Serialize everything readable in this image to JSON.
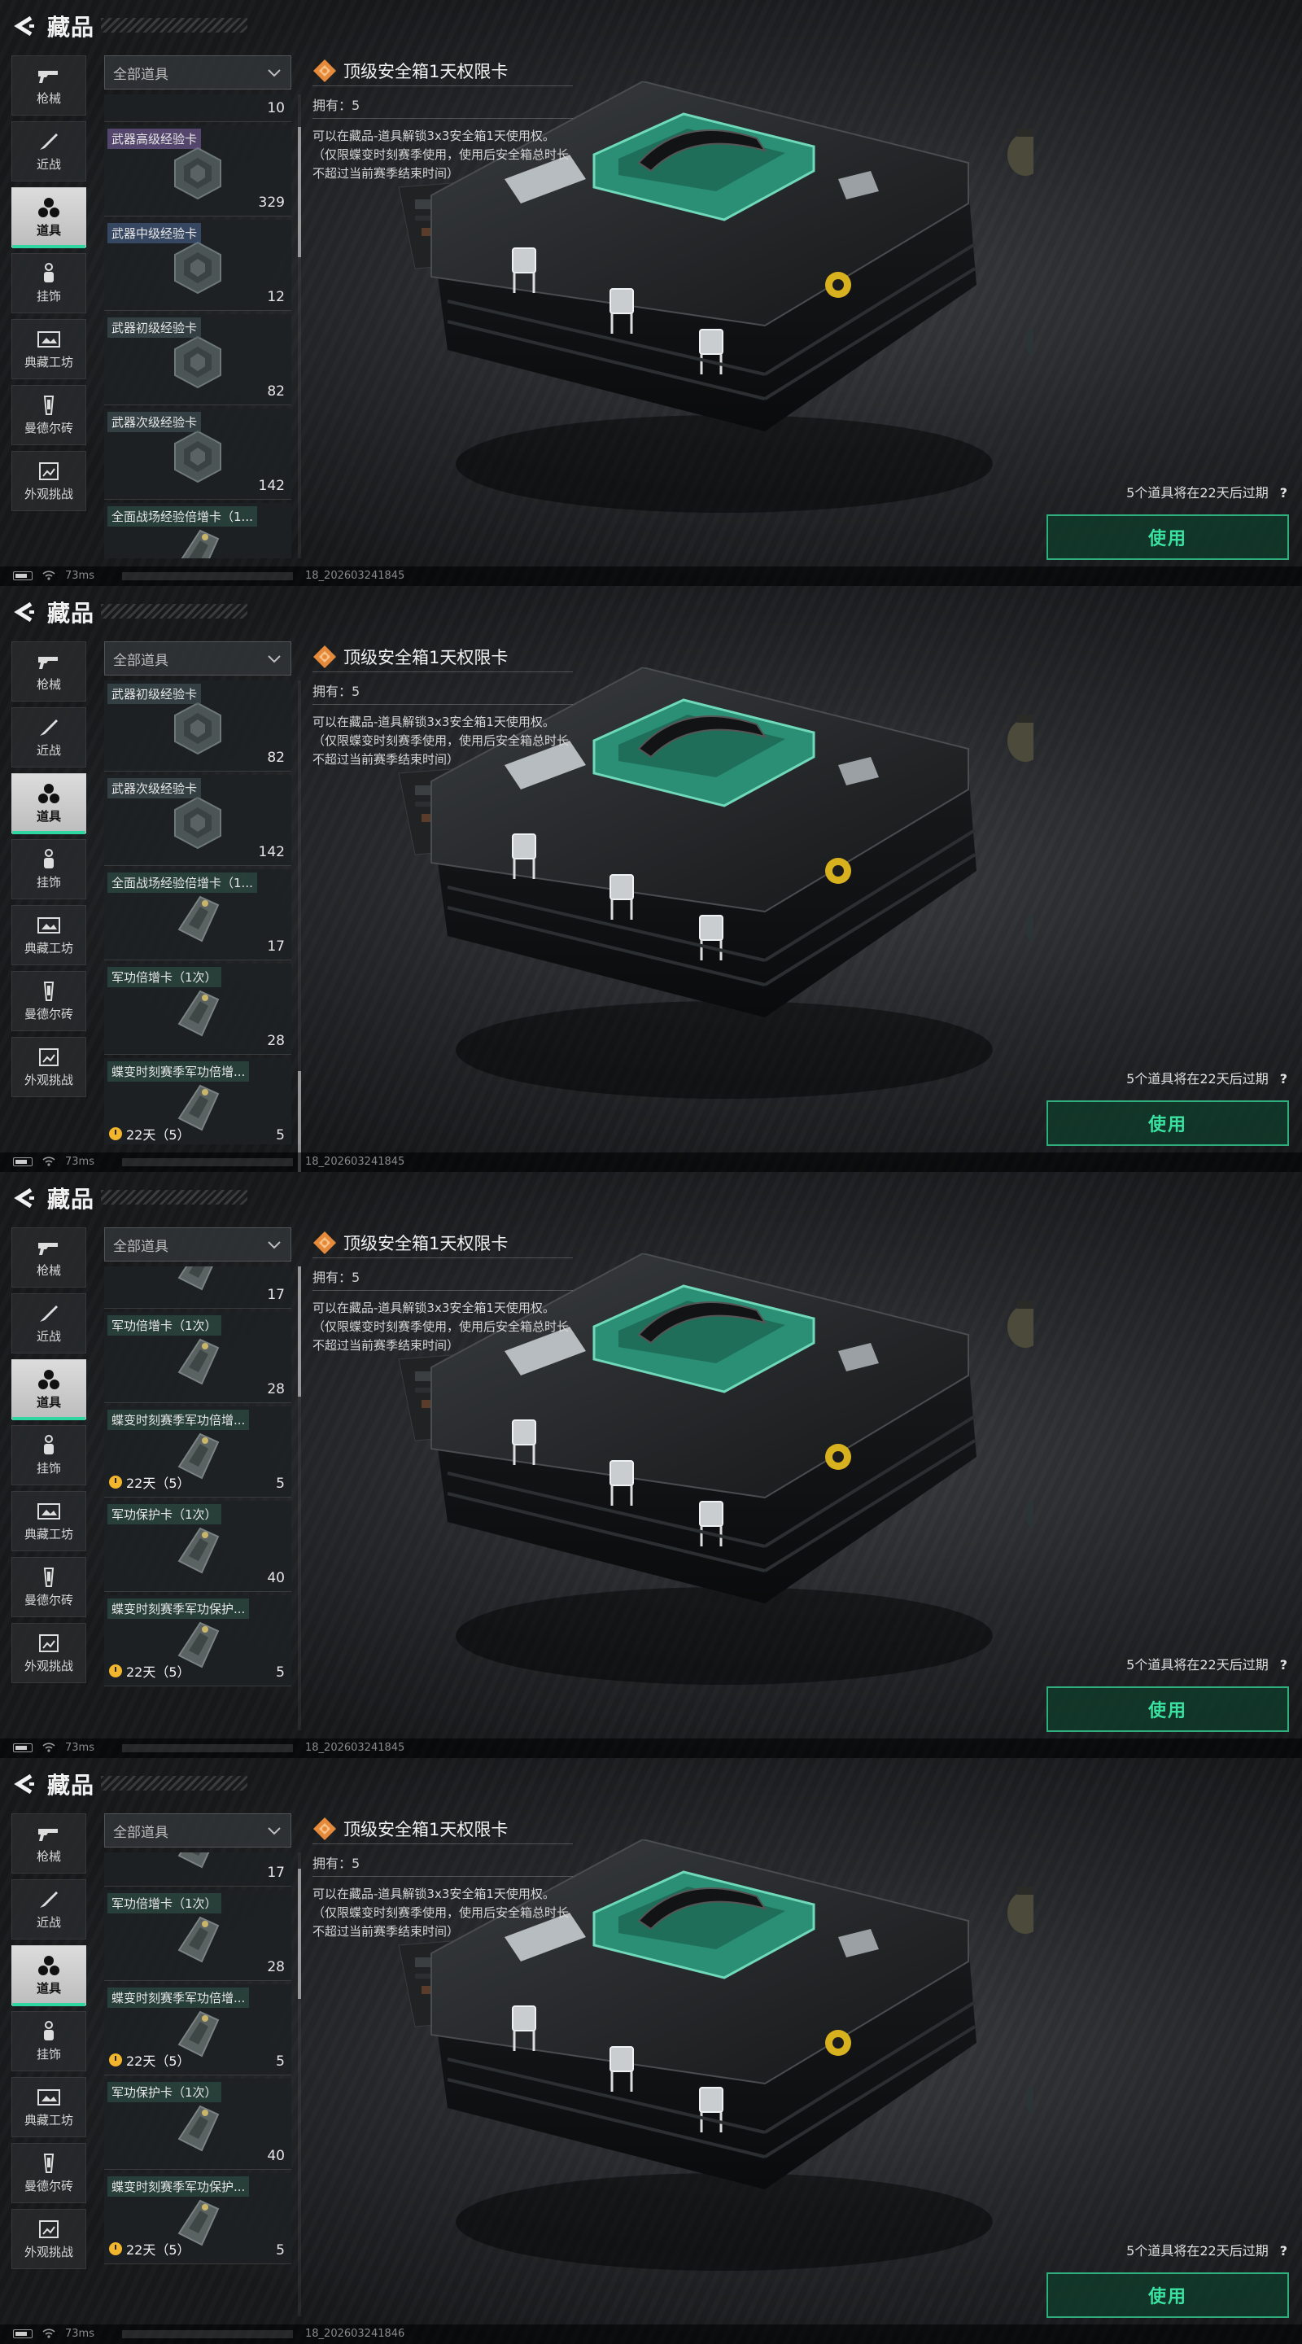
{
  "header": {
    "title": "藏品"
  },
  "nav": [
    {
      "label": "枪械",
      "icon": "gun-icon"
    },
    {
      "label": "近战",
      "icon": "knife-icon"
    },
    {
      "label": "道具",
      "icon": "items-icon"
    },
    {
      "label": "挂饰",
      "icon": "charm-icon"
    },
    {
      "label": "典藏工坊",
      "icon": "workshop-icon"
    },
    {
      "label": "曼德尔砖",
      "icon": "brick-icon"
    },
    {
      "label": "外观挑战",
      "icon": "challenge-icon"
    }
  ],
  "filter": {
    "label": "全部道具"
  },
  "detail": {
    "title": "顶级安全箱1天权限卡",
    "owned": "拥有：5",
    "description": "可以在藏品-道具解锁3x3安全箱1天使用权。（仅限蝶变时刻赛季使用，使用后安全箱总时长不超过当前赛季结束时间）",
    "expire_note": "5个道具将在22天后过期",
    "use_label": "使用"
  },
  "status": {
    "ping": "73ms"
  },
  "panels": [
    {
      "version": "18_202603241845",
      "items": [
        {
          "name": "",
          "qty": "10",
          "timer": ""
        },
        {
          "name": "武器高级经验卡",
          "qty": "329",
          "timer": ""
        },
        {
          "name": "武器中级经验卡",
          "qty": "12",
          "timer": ""
        },
        {
          "name": "武器初级经验卡",
          "qty": "82",
          "timer": ""
        },
        {
          "name": "武器次级经验卡",
          "qty": "142",
          "timer": ""
        },
        {
          "name": "全面战场经验倍增卡（1...",
          "qty": "",
          "timer": ""
        }
      ]
    },
    {
      "version": "18_202603241845",
      "items": [
        {
          "name": "武器初级经验卡",
          "qty": "82",
          "timer": ""
        },
        {
          "name": "武器次级经验卡",
          "qty": "142",
          "timer": ""
        },
        {
          "name": "全面战场经验倍增卡（1...",
          "qty": "17",
          "timer": ""
        },
        {
          "name": "军功倍增卡（1次）",
          "qty": "28",
          "timer": ""
        },
        {
          "name": "蝶变时刻赛季军功倍增...",
          "qty": "5",
          "timer": "22天（5）"
        }
      ]
    },
    {
      "version": "18_202603241845",
      "items": [
        {
          "name": "",
          "qty": "17",
          "timer": ""
        },
        {
          "name": "军功倍增卡（1次）",
          "qty": "28",
          "timer": ""
        },
        {
          "name": "蝶变时刻赛季军功倍增...",
          "qty": "5",
          "timer": "22天（5）"
        },
        {
          "name": "军功保护卡（1次）",
          "qty": "40",
          "timer": ""
        },
        {
          "name": "蝶变时刻赛季军功保护...",
          "qty": "5",
          "timer": "22天（5）"
        }
      ]
    },
    {
      "version": "18_202603241846",
      "items": [
        {
          "name": "",
          "qty": "17",
          "timer": ""
        },
        {
          "name": "军功倍增卡（1次）",
          "qty": "28",
          "timer": ""
        },
        {
          "name": "蝶变时刻赛季军功倍增...",
          "qty": "5",
          "timer": "22天（5）"
        },
        {
          "name": "军功保护卡（1次）",
          "qty": "40",
          "timer": ""
        },
        {
          "name": "蝶变时刻赛季军功保护...",
          "qty": "5",
          "timer": "22天（5）"
        }
      ]
    }
  ]
}
